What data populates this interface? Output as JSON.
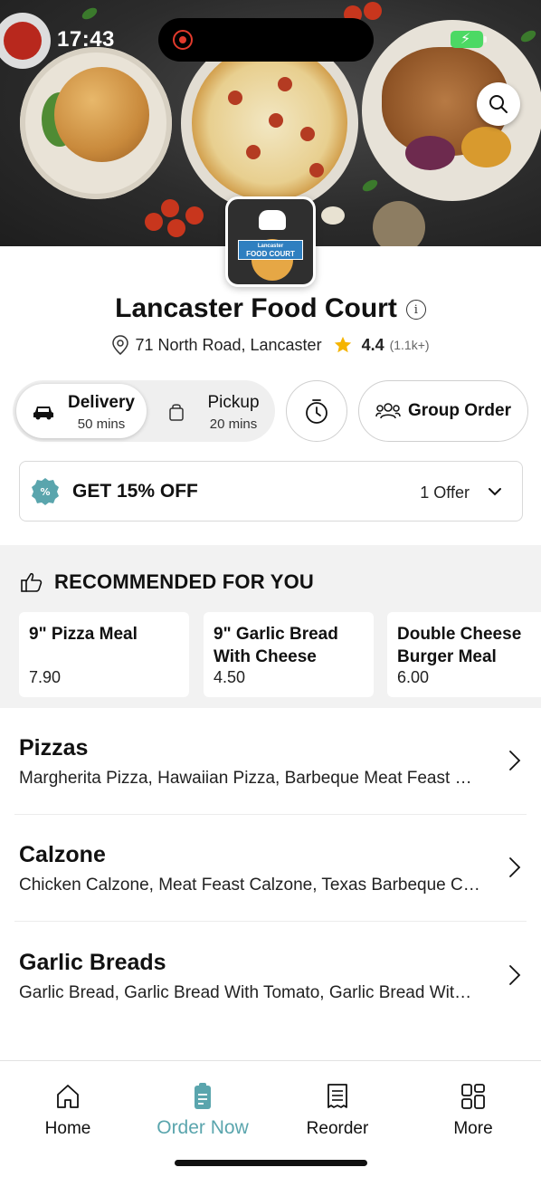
{
  "status_bar": {
    "time": "17:43"
  },
  "restaurant": {
    "name": "Lancaster Food Court",
    "address": "71 North Road, Lancaster",
    "rating": "4.4",
    "rating_count": "(1.1k+)",
    "logo_top": "Lancaster",
    "logo_bottom": "FOOD COURT"
  },
  "modes": {
    "delivery": {
      "label": "Delivery",
      "time": "50 mins"
    },
    "pickup": {
      "label": "Pickup",
      "time": "20 mins"
    },
    "group_order": "Group Order"
  },
  "offer": {
    "title": "GET 15% OFF",
    "count": "1 Offer"
  },
  "recommended": {
    "heading": "RECOMMENDED FOR YOU",
    "items": [
      {
        "name": "9\" Pizza Meal",
        "price": "7.90"
      },
      {
        "name": "9\" Garlic Bread With Cheese",
        "price": "4.50"
      },
      {
        "name": "Double Cheese Burger Meal",
        "price": "6.00"
      }
    ]
  },
  "categories": [
    {
      "name": "Pizzas",
      "desc": "Margherita Pizza, Hawaiian Pizza, Barbeque Meat Feast Pizza"
    },
    {
      "name": "Calzone",
      "desc": "Chicken Calzone, Meat Feast Calzone, Texas Barbeque Calzone"
    },
    {
      "name": "Garlic Breads",
      "desc": "Garlic Bread, Garlic Bread With Tomato, Garlic Bread With Cheese"
    }
  ],
  "nav": {
    "items": [
      {
        "label": "Home",
        "icon": "home-icon"
      },
      {
        "label": "Order Now",
        "icon": "order-icon",
        "active": true
      },
      {
        "label": "Reorder",
        "icon": "receipt-icon"
      },
      {
        "label": "More",
        "icon": "grid-icon"
      }
    ]
  },
  "colors": {
    "accent": "#5aa5ad",
    "battery": "#4cd964",
    "star": "#f5b400"
  }
}
